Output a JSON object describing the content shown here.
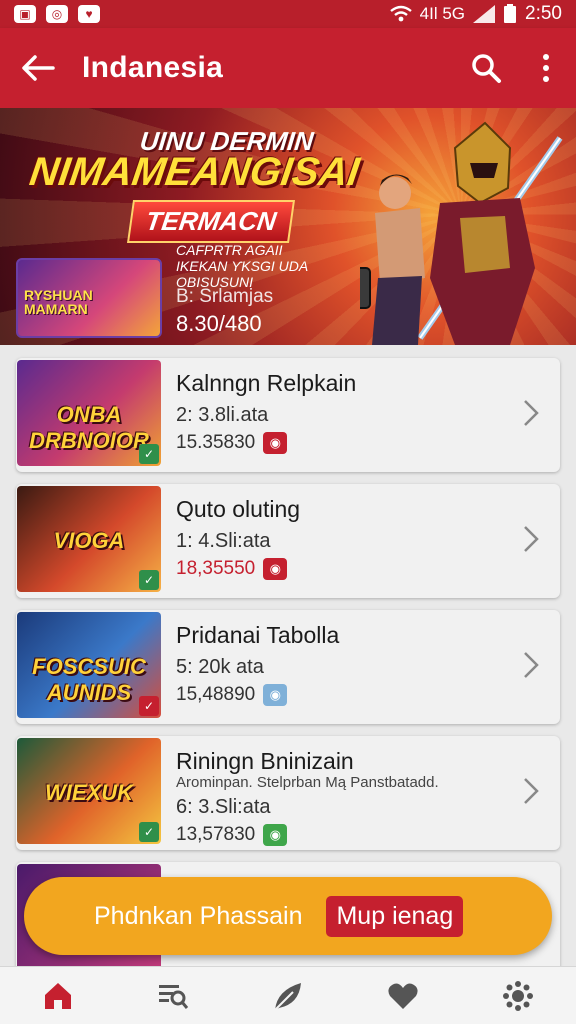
{
  "status_bar": {
    "signal_text": "4Il 5G",
    "time": "2:50"
  },
  "app_bar": {
    "title": "Indanesia"
  },
  "banner": {
    "headline_top": "UINU DERMIN",
    "headline_main": "NIMAMEANGISAI",
    "tag": "TERMACN",
    "thumb_label": "RYSHUAN MAMARN",
    "subtext": "CAFPRTR AGAII IKEKAN ƳKSGI UDA OBISUSUNI",
    "meta": "B: Srlamjas",
    "price": "8.30/480"
  },
  "games": [
    {
      "thumb_title": "ONBA DRBNOIOR",
      "title": "Kalnngn Relpkain",
      "subtitle": "",
      "meta": "2: 3.8li.ata",
      "price": "15.35830",
      "price_color": "normal",
      "badge_color": "#c5202f",
      "thumb_colors": [
        "#5a2a8f",
        "#c43b6e",
        "#f0a232"
      ]
    },
    {
      "thumb_title": "VIOGA",
      "title": "Quto oluting",
      "subtitle": "",
      "meta": "1: 4.Sli:ata",
      "price": "18,35550",
      "price_color": "red",
      "badge_color": "#c5202f",
      "thumb_colors": [
        "#3a1a12",
        "#d4492b",
        "#f6b146"
      ]
    },
    {
      "thumb_title": "FOSCSUIC AUNIDS",
      "title": "Pridanai Tabolla",
      "subtitle": "",
      "meta": "5: 20k ata",
      "price": "15,48890",
      "price_color": "normal",
      "badge_color": "#7fb0d8",
      "thumb_colors": [
        "#1b3a7a",
        "#3b79c9",
        "#d84d3a"
      ]
    },
    {
      "thumb_title": "WIEXUK",
      "title": "Riningn Bninizain",
      "subtitle": "Arominpan. Stelprban Mą Panstbatadd.",
      "meta": "6: 3.Sli:ata",
      "price": "13,57830",
      "price_color": "normal",
      "badge_color": "#3fa64a",
      "thumb_colors": [
        "#1d5a3a",
        "#e0632a",
        "#f4c640"
      ]
    }
  ],
  "cta": {
    "label": "Phdnkan Phassain",
    "button": "Mup ienag"
  },
  "nav": [
    "home-icon",
    "search-list-icon",
    "leaf-icon",
    "heart-icon",
    "settings-icon"
  ],
  "colors": {
    "primary": "#c5202f",
    "accent": "#f2a61f"
  }
}
